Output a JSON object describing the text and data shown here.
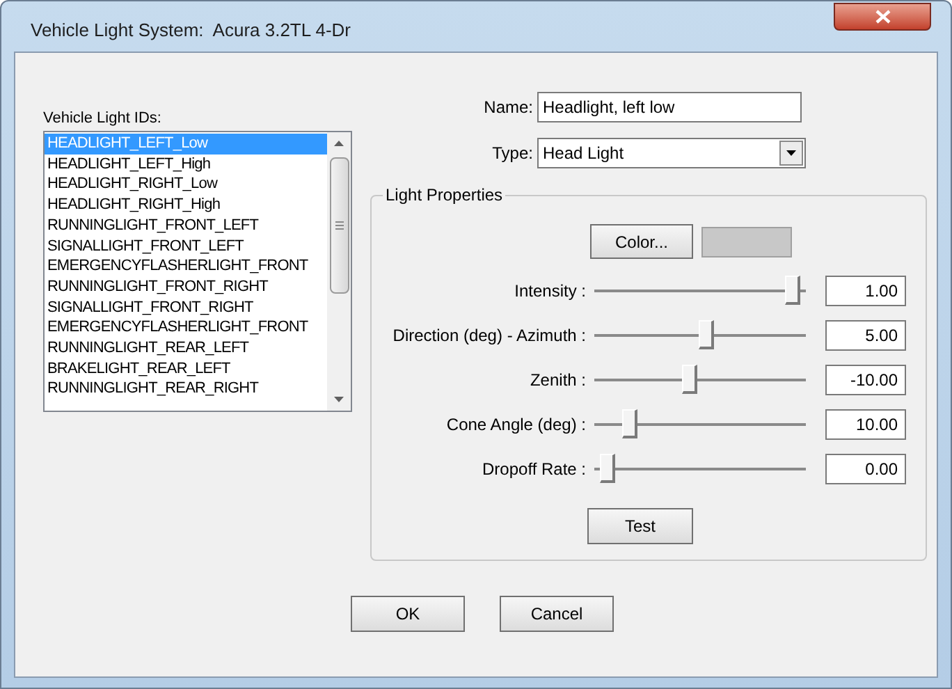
{
  "window": {
    "title": "Vehicle Light System:  Acura 3.2TL 4-Dr"
  },
  "light_ids": {
    "label": "Vehicle Light IDs:",
    "items": [
      {
        "label": "HEADLIGHT_LEFT_Low",
        "selected": true
      },
      {
        "label": "HEADLIGHT_LEFT_High",
        "selected": false
      },
      {
        "label": "HEADLIGHT_RIGHT_Low",
        "selected": false
      },
      {
        "label": "HEADLIGHT_RIGHT_High",
        "selected": false
      },
      {
        "label": "RUNNINGLIGHT_FRONT_LEFT",
        "selected": false
      },
      {
        "label": "SIGNALLIGHT_FRONT_LEFT",
        "selected": false
      },
      {
        "label": "EMERGENCYFLASHERLIGHT_FRONT",
        "selected": false
      },
      {
        "label": "RUNNINGLIGHT_FRONT_RIGHT",
        "selected": false
      },
      {
        "label": "SIGNALLIGHT_FRONT_RIGHT",
        "selected": false
      },
      {
        "label": "EMERGENCYFLASHERLIGHT_FRONT",
        "selected": false
      },
      {
        "label": "RUNNINGLIGHT_REAR_LEFT",
        "selected": false
      },
      {
        "label": "BRAKELIGHT_REAR_LEFT",
        "selected": false
      },
      {
        "label": "RUNNINGLIGHT_REAR_RIGHT",
        "selected": false
      }
    ]
  },
  "name": {
    "label": "Name:",
    "value": "Headlight, left low"
  },
  "type": {
    "label": "Type:",
    "value": "Head Light"
  },
  "light_properties": {
    "title": "Light Properties",
    "color_button": "Color...",
    "color": "#c8c8c8",
    "sliders": [
      {
        "label": "Intensity :",
        "level": 0.97,
        "value": "1.00"
      },
      {
        "label": "Direction (deg) - Azimuth :",
        "level": 0.53,
        "value": "5.00"
      },
      {
        "label": "Zenith :",
        "level": 0.45,
        "value": "-10.00"
      },
      {
        "label": "Cone Angle (deg) :",
        "level": 0.14,
        "value": "10.00"
      },
      {
        "label": "Dropoff Rate :",
        "level": 0.03,
        "value": "0.00"
      }
    ],
    "test_button": "Test"
  },
  "buttons": [
    "OK",
    "Cancel"
  ]
}
